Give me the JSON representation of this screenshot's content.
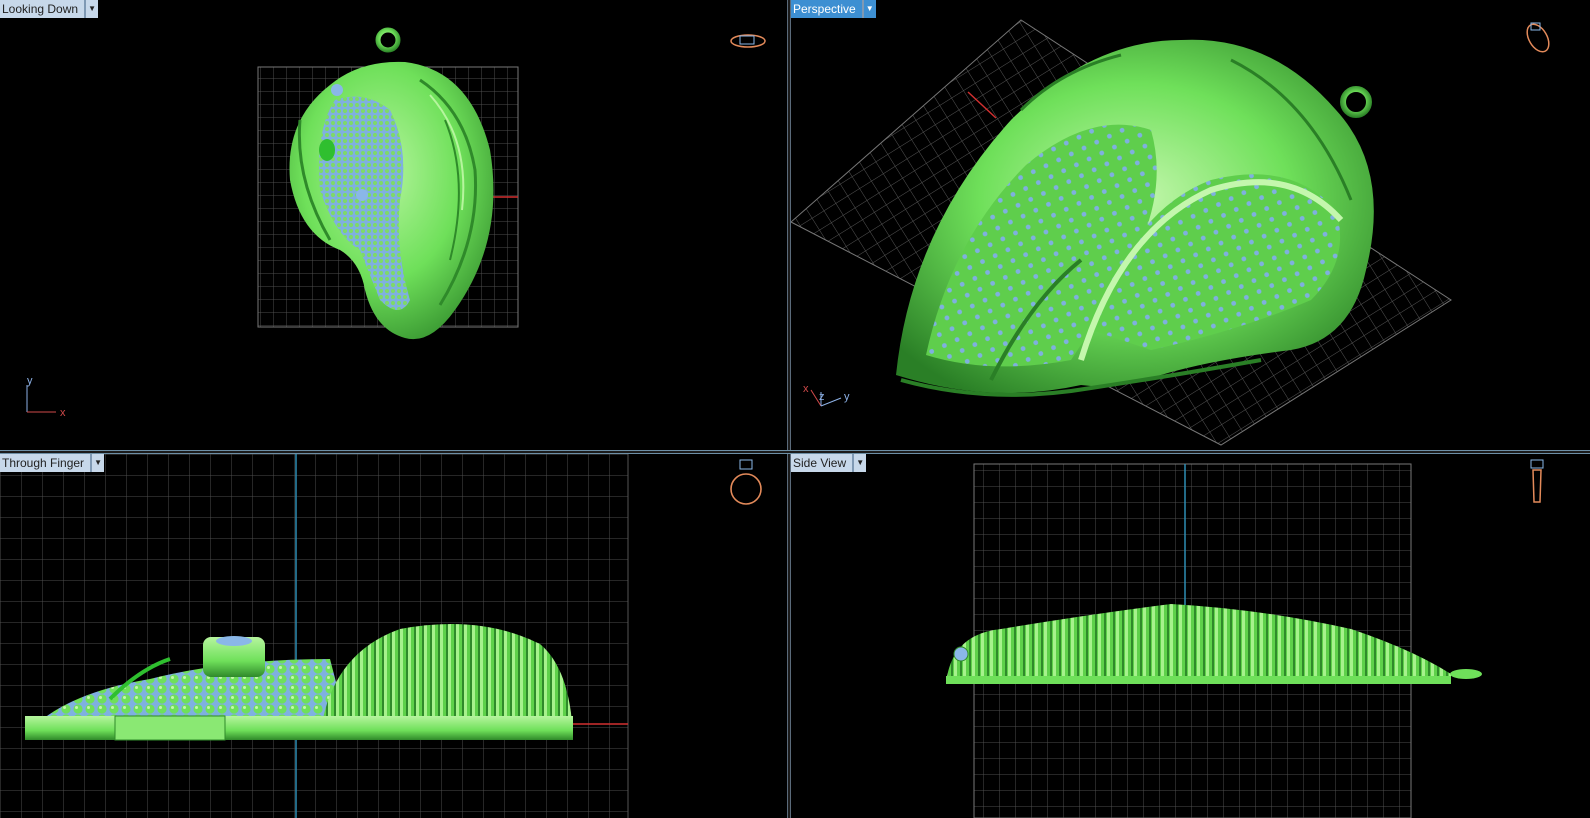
{
  "viewports": {
    "top_left": {
      "label": "Looking Down",
      "icon": "ring-top-icon",
      "axes": {
        "y": "y",
        "x": "x"
      }
    },
    "top_right": {
      "label": "Perspective",
      "icon": "ring-perspective-icon",
      "axes": {
        "x": "x",
        "z": "z",
        "y": "y"
      }
    },
    "bottom_left": {
      "label": "Through Finger",
      "icon": "ring-front-icon"
    },
    "bottom_right": {
      "label": "Side View",
      "icon": "ring-side-icon"
    }
  },
  "colors": {
    "model": "#6fe05a",
    "model_dark": "#2f8a2a",
    "gem": "#8ab7e8",
    "grid": "#4d4d4d",
    "axis_blue": "#2e8db4",
    "axis_red": "#d23030",
    "label_bg": "#c7d8ea",
    "label_active_bg": "#3d8fd2",
    "icon": "#e38a5a"
  }
}
